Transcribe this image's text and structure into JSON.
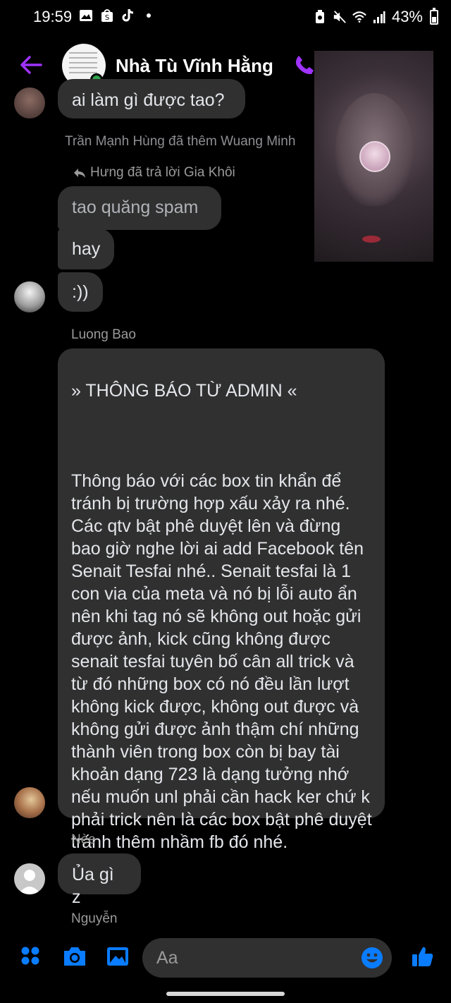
{
  "status_bar": {
    "time": "19:59",
    "battery": "43%",
    "battery_level": 0.43
  },
  "header": {
    "title": "Nhà Tù Vĩnh Hằng",
    "accent_color": "#a033ff"
  },
  "messages": {
    "partial_top": "ai làm gì được tao?",
    "system_added": "Trần Mạnh Hùng đã thêm Wuang Minh",
    "reply_note": "Hưng đã trả lời Gia Khôi",
    "m1": "tao quăng spam",
    "m2": "hay",
    "m3": ":))",
    "sender_luongbao": "Luong Bao",
    "announcement_title": "» THÔNG BÁO TỪ ADMIN «",
    "announcement_body": "Thông báo với các box tin khẩn để tránh bị trường hợp xấu xảy ra nhé. Các qtv bật phê duyệt lên và đừng bao giờ nghe lời ai add Facebook tên Senait Tesfai nhé.. Senait tesfai là 1 con via của meta và nó bị lỗi auto ẩn nên khi tag nó sẽ không out hoặc gửi được ảnh, kick cũng không được senait tesfai tuyên bố cân all trick và từ đó những box có nó đều lần lượt không kick được, không out được và không gửi được ảnh thậm chí những thành viên trong box còn bị bay tài khoản dạng 723 là dạng tưởng nhớ nếu muốn unl phải cần hack ker chứ k phải trick nên là các box bật phê duyệt tránh thêm nhầm fb đó nhé.",
    "sender_nee": "Nèe",
    "m_nee": "Ủa gì z",
    "sender_nguyen": "Nguyễn"
  },
  "composer": {
    "placeholder": "Aa"
  },
  "icons": {
    "back": "back-arrow-icon",
    "call": "phone-icon",
    "menu": "apps-grid-icon",
    "camera": "camera-icon",
    "gallery": "image-icon",
    "emoji": "emoji-icon",
    "like": "thumbs-up-icon"
  },
  "colors": {
    "accent": "#a033ff",
    "messenger_blue": "#0a7cff",
    "bubble": "#303030",
    "online": "#31a24c"
  }
}
